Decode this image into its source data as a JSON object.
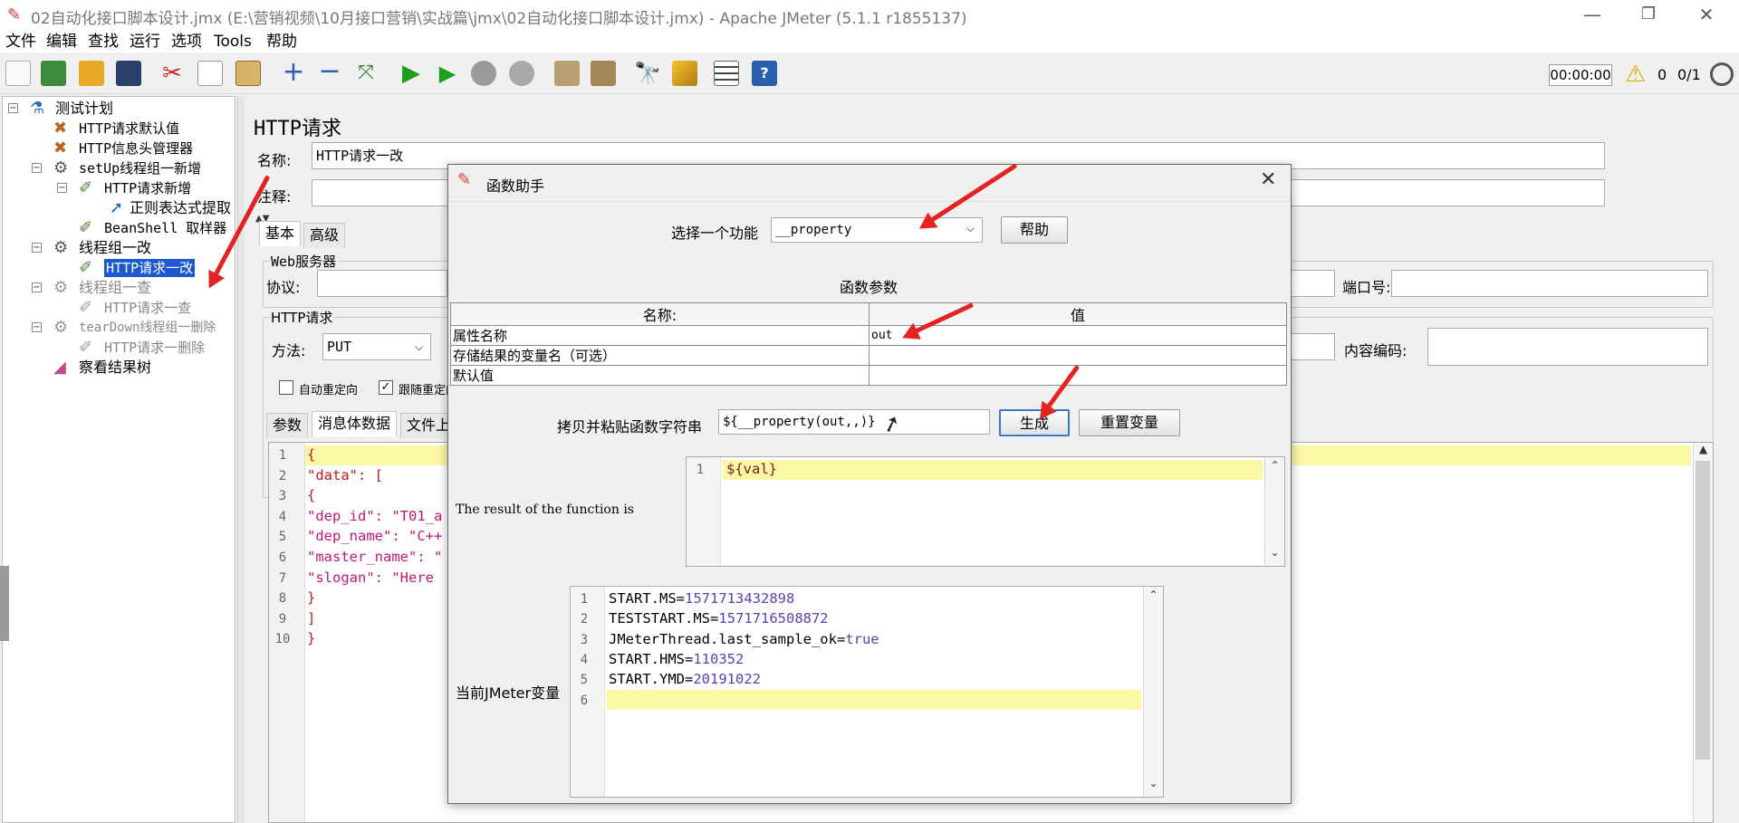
{
  "window": {
    "title": "02自动化接口脚本设计.jmx (E:\\营销视频\\10月接口营销\\实战篇\\jmx\\02自动化接口脚本设计.jmx) - Apache JMeter (5.1.1 r1855137)",
    "minimize": "—",
    "restore": "❐",
    "close": "✕"
  },
  "menu": [
    "文件",
    "编辑",
    "查找",
    "运行",
    "选项",
    "Tools",
    "帮助"
  ],
  "toolbar": {
    "timer": "00:00:00",
    "warnings": "0",
    "threads": "0/1"
  },
  "tree": {
    "root": "测试计划",
    "items": [
      {
        "label": "HTTP请求默认值"
      },
      {
        "label": "HTTP信息头管理器"
      },
      {
        "label": "setUp线程组一新增"
      },
      {
        "label": "HTTP请求新增"
      },
      {
        "label": "正则表达式提取"
      },
      {
        "label": "BeanShell 取样器"
      },
      {
        "label": "线程组一改"
      },
      {
        "label": "HTTP请求一改"
      },
      {
        "label": "线程组一查"
      },
      {
        "label": "HTTP请求一查"
      },
      {
        "label": "tearDown线程组一删除"
      },
      {
        "label": "HTTP请求一删除"
      },
      {
        "label": "察看结果树"
      }
    ]
  },
  "panel": {
    "heading": "HTTP请求",
    "name_label": "名称:",
    "name_value": "HTTP请求一改",
    "comment_label": "注释:",
    "tab_basic": "基本",
    "tab_advanced": "高级",
    "web_server": "Web服务器",
    "protocol_label": "协议:",
    "port_label": "端口号:",
    "http_request": "HTTP请求",
    "method_label": "方法:",
    "method_value": "PUT",
    "encoding_label": "内容编码:",
    "auto_redirect": "自动重定向",
    "follow_redirect": "跟随重定向",
    "tab_params": "参数",
    "tab_body": "消息体数据",
    "tab_files": "文件上",
    "body_lines": [
      "{",
      "\"data\": [",
      "{",
      "\"dep_id\": \"T01_a",
      "\"dep_name\": \"C++",
      "\"master_name\": \"",
      "\"slogan\": \"Here ",
      "}",
      "]",
      "}"
    ]
  },
  "dialog": {
    "title": "函数助手",
    "select_label": "选择一个功能",
    "select_value": "__property",
    "help_button": "帮助",
    "params_label": "函数参数",
    "col_name": "名称:",
    "col_value": "值",
    "params": [
      {
        "name": "属性名称",
        "value": "out"
      },
      {
        "name": "存储结果的变量名（可选）",
        "value": ""
      },
      {
        "name": "默认值",
        "value": ""
      }
    ],
    "copy_label": "拷贝并粘贴函数字符串",
    "function_string": "${__property(out,,)}",
    "generate_button": "生成",
    "reset_button": "重置变量",
    "result_label": "The result of the function is",
    "result_code": "${val}",
    "vars_label": "当前JMeter变量",
    "vars": [
      {
        "key": "START.MS",
        "value": "1571713432898"
      },
      {
        "key": "TESTSTART.MS",
        "value": "1571716508872"
      },
      {
        "key": "JMeterThread.last_sample_ok",
        "value": "true"
      },
      {
        "key": "START.HMS",
        "value": "110352"
      },
      {
        "key": "START.YMD",
        "value": "20191022"
      }
    ]
  }
}
